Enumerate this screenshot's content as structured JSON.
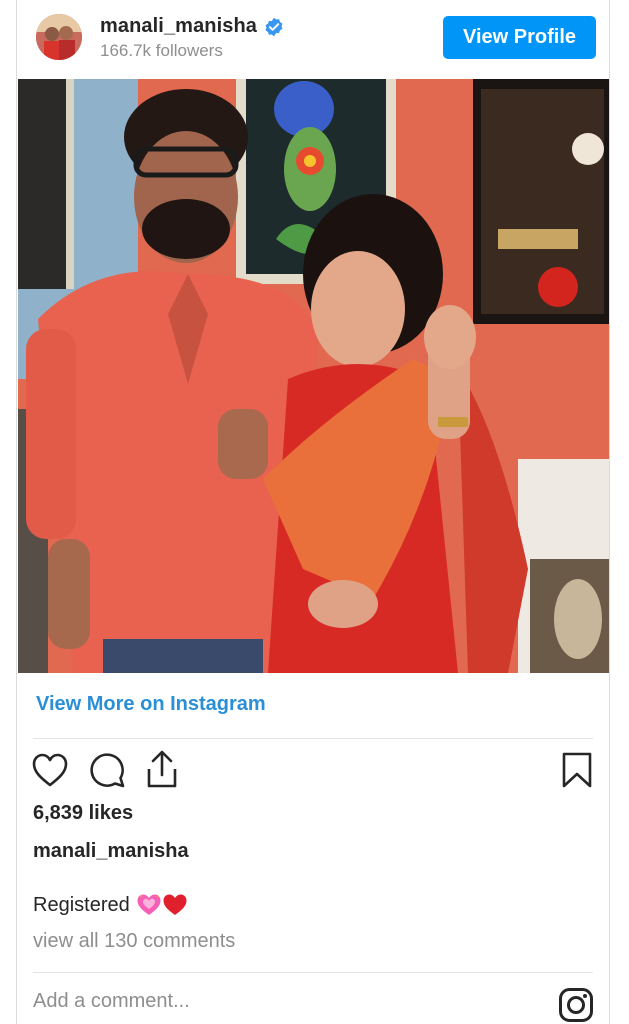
{
  "header": {
    "username": "manali_manisha",
    "followers": "166.7k followers",
    "view_profile_label": "View Profile",
    "verified_icon": "verified-badge-icon"
  },
  "post": {
    "view_more_label": "View More on Instagram",
    "likes": "6,839 likes",
    "author": "manali_manisha",
    "caption_text": "Registered",
    "caption_emojis": [
      "growing-heart-icon",
      "red-heart-icon"
    ],
    "view_comments": "view all 130 comments",
    "comment_placeholder": "Add a comment..."
  },
  "icons": {
    "like": "heart-outline-icon",
    "comment": "comment-bubble-icon",
    "share": "share-upload-icon",
    "save": "bookmark-icon",
    "brand": "instagram-logo-icon"
  },
  "colors": {
    "accent": "#0095f6",
    "link": "#2b8fd6",
    "text": "#262626",
    "muted": "#8e8e8e",
    "divider": "#e3e3e3"
  }
}
